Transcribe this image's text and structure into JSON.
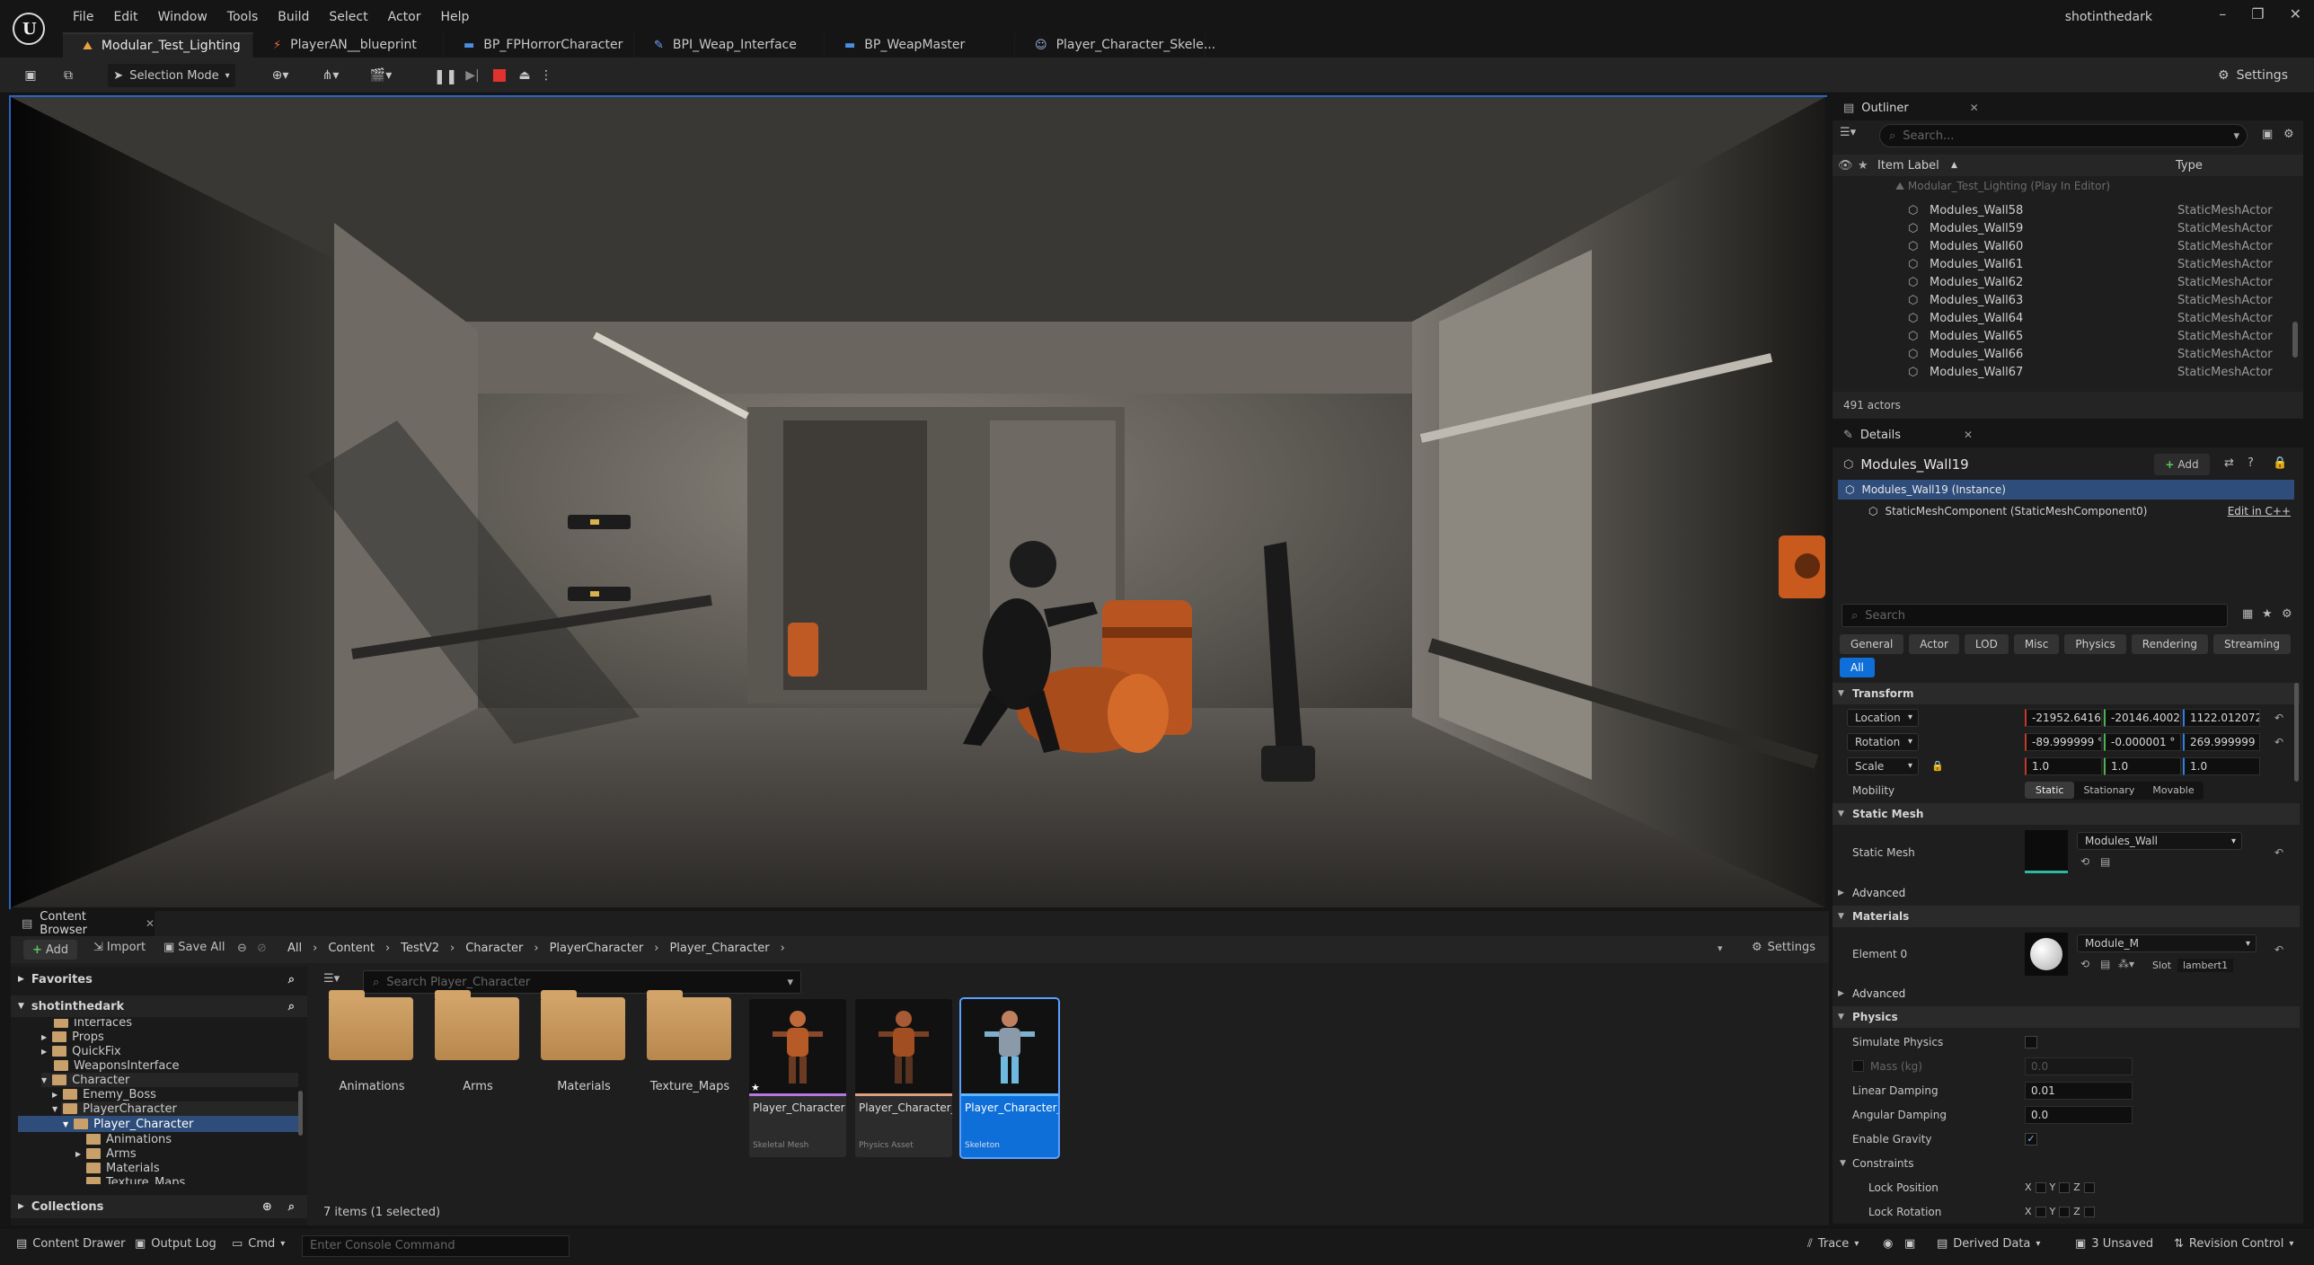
{
  "menu": [
    "File",
    "Edit",
    "Window",
    "Tools",
    "Build",
    "Select",
    "Actor",
    "Help"
  ],
  "tabs": [
    {
      "label": "Modular_Test_Lighting",
      "icon": "level-icon"
    },
    {
      "label": "PlayerAN__blueprint",
      "icon": "animation-icon"
    },
    {
      "label": "BP_FPHorrorCharacter",
      "icon": "blueprint-icon"
    },
    {
      "label": "BPI_Weap_Interface",
      "icon": "interface-icon"
    },
    {
      "label": "BP_WeapMaster",
      "icon": "blueprint-icon"
    },
    {
      "label": "Player_Character_Skele...",
      "icon": "skeleton-icon"
    }
  ],
  "user": "shotinthedark",
  "toolbar": {
    "selection_mode": "Selection Mode",
    "settings": "Settings"
  },
  "outliner": {
    "title": "Outliner",
    "search": "Search...",
    "col_label": "Item Label",
    "col_type": "Type",
    "parent": "Modular_Test_Lighting (Play In Editor)",
    "rows": [
      {
        "name": "Modules_Wall58",
        "type": "StaticMeshActor"
      },
      {
        "name": "Modules_Wall59",
        "type": "StaticMeshActor"
      },
      {
        "name": "Modules_Wall60",
        "type": "StaticMeshActor"
      },
      {
        "name": "Modules_Wall61",
        "type": "StaticMeshActor"
      },
      {
        "name": "Modules_Wall62",
        "type": "StaticMeshActor"
      },
      {
        "name": "Modules_Wall63",
        "type": "StaticMeshActor"
      },
      {
        "name": "Modules_Wall64",
        "type": "StaticMeshActor"
      },
      {
        "name": "Modules_Wall65",
        "type": "StaticMeshActor"
      },
      {
        "name": "Modules_Wall66",
        "type": "StaticMeshActor"
      },
      {
        "name": "Modules_Wall67",
        "type": "StaticMeshActor"
      }
    ],
    "count": "491 actors"
  },
  "details": {
    "title": "Details",
    "object": "Modules_Wall19",
    "add": "Add",
    "instance": "Modules_Wall19 (Instance)",
    "component": "StaticMeshComponent (StaticMeshComponent0)",
    "edit_cpp": "Edit in C++",
    "search": "Search",
    "categories": [
      "General",
      "Actor",
      "LOD",
      "Misc",
      "Physics",
      "Rendering",
      "Streaming"
    ],
    "all": "All",
    "transform": "Transform",
    "location_lbl": "Location",
    "rotation_lbl": "Rotation",
    "scale_lbl": "Scale",
    "location": [
      "-21952.641652",
      "-20146.400228",
      "1122.012072"
    ],
    "rotation": [
      "-89.999999 °",
      "-0.000001 °",
      "269.999999 °"
    ],
    "scale": [
      "1.0",
      "1.0",
      "1.0"
    ],
    "mobility": "Mobility",
    "mob_opts": [
      "Static",
      "Stationary",
      "Movable"
    ],
    "static_mesh_sect": "Static Mesh",
    "static_mesh_lbl": "Static Mesh",
    "static_mesh_val": "Modules_Wall",
    "advanced": "Advanced",
    "materials": "Materials",
    "element0": "Element 0",
    "material_val": "Module_M",
    "slot_lbl": "Slot",
    "slot_val": "lambert1",
    "physics": "Physics",
    "simulate": "Simulate Physics",
    "mass": "Mass (kg)",
    "mass_val": "0.0",
    "linear_damping": "Linear Damping",
    "linear_val": "0.01",
    "angular_damping": "Angular Damping",
    "angular_val": "0.0",
    "gravity": "Enable Gravity",
    "constraints": "Constraints",
    "lock_pos": "Lock Position",
    "lock_rot": "Lock Rotation",
    "axes": [
      "X",
      "Y",
      "Z"
    ]
  },
  "content_browser": {
    "title": "Content Browser",
    "add": "Add",
    "import": "Import",
    "save_all": "Save All",
    "path": [
      "All",
      "Content",
      "TestV2",
      "Character",
      "PlayerCharacter",
      "Player_Character"
    ],
    "settings": "Settings",
    "favorites": "Favorites",
    "root": "shotinthedark",
    "tree": [
      "Interfaces",
      "Props",
      "QuickFix",
      "WeaponsInterface",
      "Character",
      "Enemy_Boss",
      "PlayerCharacter",
      "Player_Character",
      "Animations",
      "Arms",
      "Materials",
      "Texture_Maps"
    ],
    "collections": "Collections",
    "search": "Search Player_Character",
    "folders": [
      "Animations",
      "Arms",
      "Materials",
      "Texture_Maps"
    ],
    "assets": [
      {
        "name": "Player_Character",
        "type": "Skeletal Mesh",
        "bar": "#b678e0"
      },
      {
        "name": "Player_Character_PhysicsAsset",
        "type": "Physics Asset",
        "bar": "#e0a080"
      },
      {
        "name": "Player_Character_Skeleton",
        "type": "Skeleton",
        "bar": "#5fb8ff"
      }
    ],
    "count": "7 items (1 selected)"
  },
  "status": {
    "content_drawer": "Content Drawer",
    "output_log": "Output Log",
    "cmd": "Cmd",
    "console_placeholder": "Enter Console Command",
    "trace": "Trace",
    "derived": "Derived Data",
    "unsaved": "3 Unsaved",
    "revision": "Revision Control"
  },
  "colors": {
    "accent": "#0e6fd8",
    "selection": "#2e4d7a",
    "panel": "#1e1e1e"
  }
}
